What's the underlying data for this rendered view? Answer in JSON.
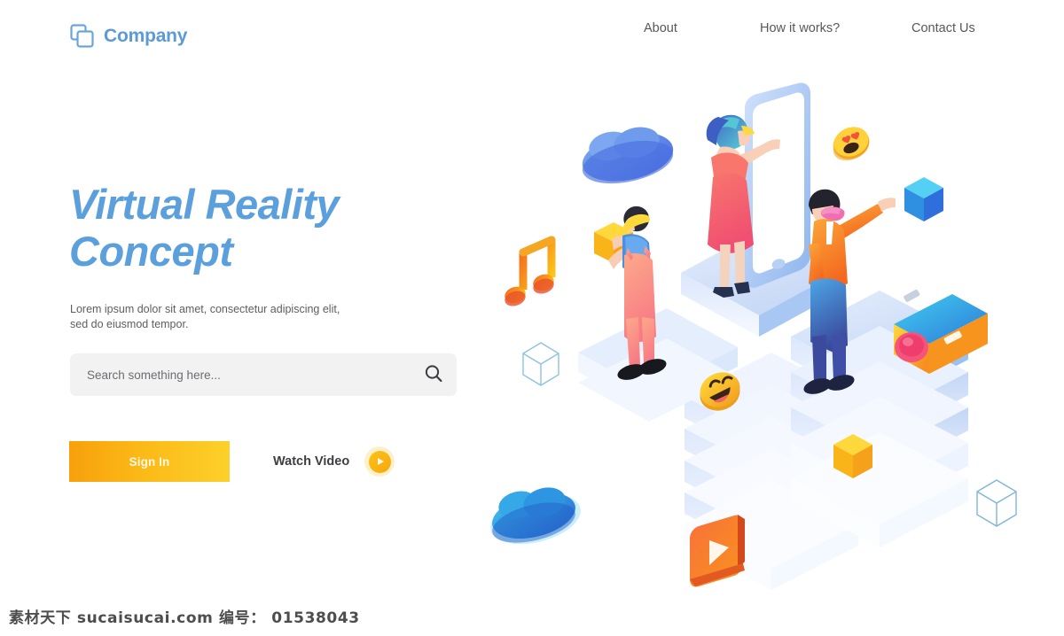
{
  "brand": {
    "name": "Company",
    "logo_icon": "two-overlapping-squares-icon",
    "color": "#5b9bd5"
  },
  "nav": {
    "items": [
      {
        "label": "About",
        "name": "nav-link-about"
      },
      {
        "label": "How it works?",
        "name": "nav-link-how-it-works"
      },
      {
        "label": "Contact Us",
        "name": "nav-link-contact-us"
      }
    ]
  },
  "hero": {
    "title": "Virtual Reality\nConcept",
    "subtitle": "Lorem ipsum dolor sit amet, consectetur adipiscing elit,\nsed do eiusmod tempor.",
    "title_color": "#5b9fdd"
  },
  "search": {
    "value": "",
    "placeholder": "Search something here...",
    "icon": "search-icon",
    "background": "#f2f2f3"
  },
  "cta": {
    "signin_label": "Sign In",
    "signin_gradient_from": "#f8a00c",
    "signin_gradient_to": "#fdd02a",
    "watch_label": "Watch Video",
    "play_icon": "play-icon",
    "play_color": "#fcc21b"
  },
  "illustration": {
    "alt": "isometric virtual reality concept illustration",
    "elements": [
      "cloud-blue-icon",
      "music-note-icon",
      "wireframe-cube-outline-icon",
      "person-overalls-holding-yellow-cube",
      "smartphone-isometric",
      "woman-pink-dress-vr-headset",
      "heart-eyes-emoji-icon",
      "blue-cube-icon",
      "man-orange-jacket-vr-headset",
      "camera-icon",
      "smiling-emoji-icon",
      "yellow-cube-icon",
      "play-button-orange-icon",
      "cloud-teal-icon",
      "wireframe-cube-outline-icon-2"
    ],
    "palette": {
      "platform_light": "#e9f0fd",
      "platform_mid": "#cdddf8",
      "platform_edge": "#8db4ec",
      "accent_blue": "#5b9fdd",
      "accent_orange": "#f7941e",
      "accent_pink": "#f4657a",
      "accent_yellow": "#fdc62e"
    }
  },
  "watermark": {
    "text": "素材天下 sucaisucai.com  编号： 01538043"
  }
}
